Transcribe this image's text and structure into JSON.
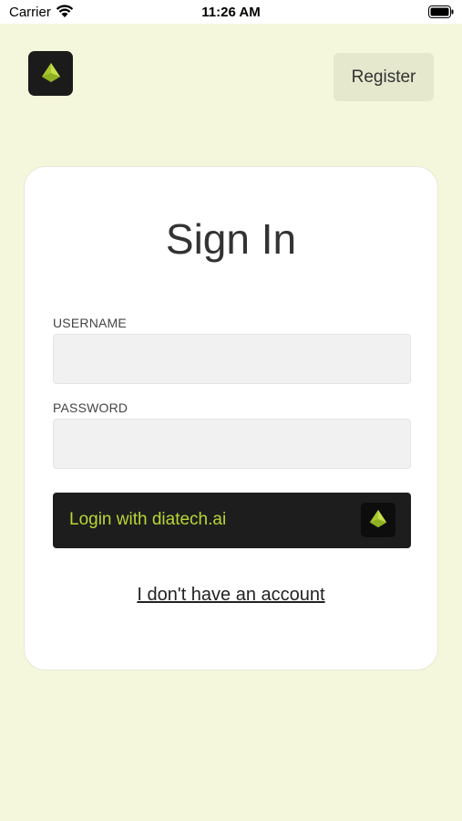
{
  "status_bar": {
    "carrier": "Carrier",
    "time": "11:26 AM",
    "icons": [
      "wifi-icon",
      "battery-icon"
    ]
  },
  "header": {
    "logo_icon": "diatech-logo-icon",
    "register_label": "Register"
  },
  "card": {
    "title": "Sign In",
    "username_label": "USERNAME",
    "username_value": "",
    "password_label": "PASSWORD",
    "password_value": "",
    "login_button_label": "Login with diatech.ai",
    "login_button_icon": "diatech-logo-icon",
    "no_account_link": "I don't have an account"
  },
  "colors": {
    "background": "#f5f7dd",
    "accent": "#b7d637",
    "dark": "#1d1d1d",
    "register_bg": "#e5e8cc"
  }
}
